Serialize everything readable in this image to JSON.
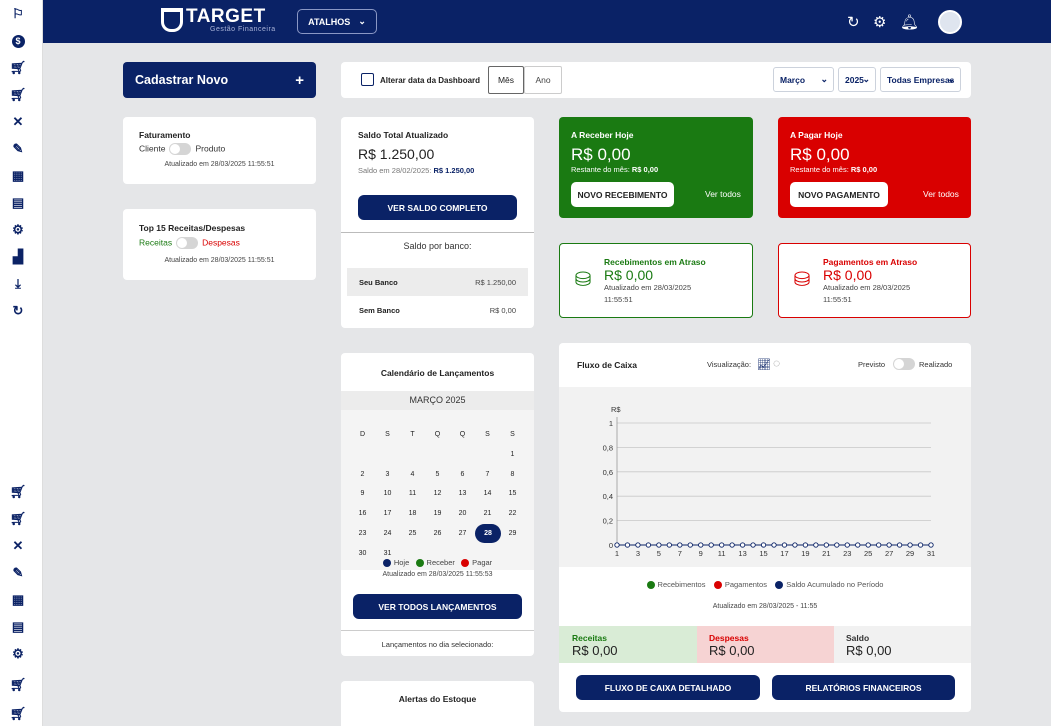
{
  "header": {
    "brand": "TARGET",
    "brand_sub": "Gestão Financeira",
    "shortcuts_label": "ATALHOS"
  },
  "colors": {
    "navy": "#0a2266",
    "green": "#1a7a12",
    "red": "#d90000"
  },
  "register": {
    "label": "Cadastrar Novo",
    "plus": "+"
  },
  "faturamento": {
    "title": "Faturamento",
    "left": "Cliente",
    "right": "Produto",
    "updated": "Atualizado em 28/03/2025 11:55:51"
  },
  "top15": {
    "title": "Top 15 Receitas/Despesas",
    "left": "Receitas",
    "right": "Despesas",
    "updated": "Atualizado em 28/03/2025 11:55:51"
  },
  "date_bar": {
    "label": "Alterar data da Dashboard",
    "tab_month": "Mês",
    "tab_year": "Ano",
    "month": "Março",
    "year": "2025",
    "company": "Todas Empresas"
  },
  "saldo": {
    "title": "Saldo Total Atualizado",
    "value": "R$ 1.250,00",
    "prev_label": "Saldo em 28/02/2025:",
    "prev_value": "R$ 1.250,00",
    "button": "VER SALDO COMPLETO",
    "by_bank_label": "Saldo por banco:",
    "banks": [
      {
        "name": "Seu Banco",
        "value": "R$ 1.250,00"
      },
      {
        "name": "Sem Banco",
        "value": "R$ 0,00"
      }
    ]
  },
  "receber": {
    "title": "A Receber Hoje",
    "value": "R$ 0,00",
    "rest_label": "Restante do mês:",
    "rest_value": "R$ 0,00",
    "button": "NOVO RECEBIMENTO",
    "see_all": "Ver todos"
  },
  "pagar": {
    "title": "A Pagar Hoje",
    "value": "R$ 0,00",
    "rest_label": "Restante do mês:",
    "rest_value": "R$ 0,00",
    "button": "NOVO PAGAMENTO",
    "see_all": "Ver todos"
  },
  "receb_atraso": {
    "title": "Recebimentos em Atraso",
    "value": "R$ 0,00",
    "updated": "Atualizado em 28/03/2025",
    "time": "11:55:51"
  },
  "pag_atraso": {
    "title": "Pagamentos em Atraso",
    "value": "R$ 0,00",
    "updated": "Atualizado em 28/03/2025",
    "time": "11:55:51"
  },
  "calendar": {
    "title": "Calendário de Lançamentos",
    "month": "MARÇO 2025",
    "weekdays": [
      "D",
      "S",
      "T",
      "Q",
      "Q",
      "S",
      "S"
    ],
    "first_weekday": 6,
    "days_in_month": 31,
    "selected_day": 28,
    "legend": [
      "Hoje",
      "Receber",
      "Pagar"
    ],
    "updated": "Atualizado em 28/03/2025 11:55:53",
    "button": "VER TODOS LANÇAMENTOS",
    "selected_label": "Lançamentos no dia selecionado:"
  },
  "estoque": {
    "title": "Alertas do Estoque"
  },
  "fluxo": {
    "title": "Fluxo de Caixa",
    "view_label": "Visualização:",
    "toggle_left": "Previsto",
    "toggle_right": "Realizado",
    "legend": [
      "Recebimentos",
      "Pagamentos",
      "Saldo Acumulado no Período"
    ],
    "updated": "Atualizado em 28/03/2025 - 11:55",
    "receitas_label": "Receitas",
    "receitas_value": "R$ 0,00",
    "despesas_label": "Despesas",
    "despesas_value": "R$ 0,00",
    "saldo_label": "Saldo",
    "saldo_value": "R$ 0,00",
    "btn_detail": "FLUXO DE CAIXA DETALHADO",
    "btn_reports": "RELATÓRIOS FINANCEIROS"
  },
  "chart_data": {
    "type": "line",
    "ylabel": "R$",
    "ylim": [
      0,
      1
    ],
    "yticks": [
      "0",
      "0,2",
      "0,4",
      "0,6",
      "0,8",
      "1"
    ],
    "x": [
      1,
      2,
      3,
      4,
      5,
      6,
      7,
      8,
      9,
      10,
      11,
      12,
      13,
      14,
      15,
      16,
      17,
      18,
      19,
      20,
      21,
      22,
      23,
      24,
      25,
      26,
      27,
      28,
      29,
      30,
      31
    ],
    "xtick_labels": [
      "1",
      "3",
      "5",
      "7",
      "9",
      "11",
      "13",
      "15",
      "17",
      "19",
      "21",
      "23",
      "25",
      "27",
      "29",
      "31"
    ],
    "series": [
      {
        "values": [
          0,
          0,
          0,
          0,
          0,
          0,
          0,
          0,
          0,
          0,
          0,
          0,
          0,
          0,
          0,
          0,
          0,
          0,
          0,
          0,
          0,
          0,
          0,
          0,
          0,
          0,
          0,
          0,
          0,
          0,
          0
        ]
      }
    ],
    "grid": true
  }
}
